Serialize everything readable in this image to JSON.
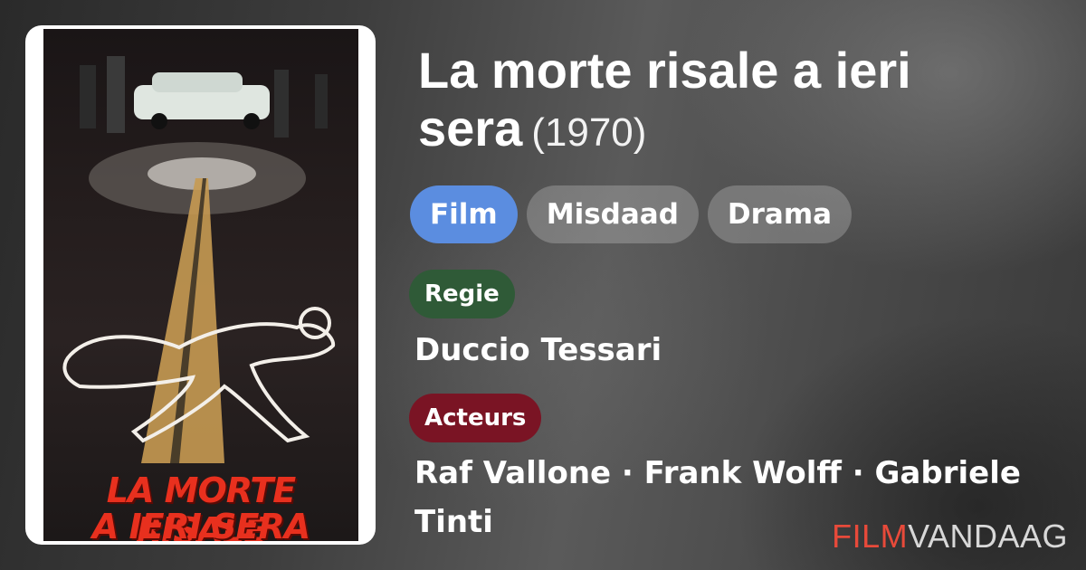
{
  "poster": {
    "title_line1": "LA MORTE RISALE",
    "title_line2": "A IERI SERA"
  },
  "movie": {
    "title": "La morte risale a ieri sera",
    "year": "(1970)"
  },
  "genres": [
    "Film",
    "Misdaad",
    "Drama"
  ],
  "director_section": {
    "label": "Regie",
    "value": "Duccio Tessari",
    "label_color": "#2f5a37"
  },
  "actors_section": {
    "label": "Acteurs",
    "value": "Raf Vallone · Frank Wolff · Gabriele Tinti",
    "label_color": "#7a1424"
  },
  "brand": {
    "part1": "FILM",
    "part2": "VANDAAG",
    "accent": "#e84a3a"
  },
  "colors": {
    "primary_chip": "#5b8de0"
  }
}
